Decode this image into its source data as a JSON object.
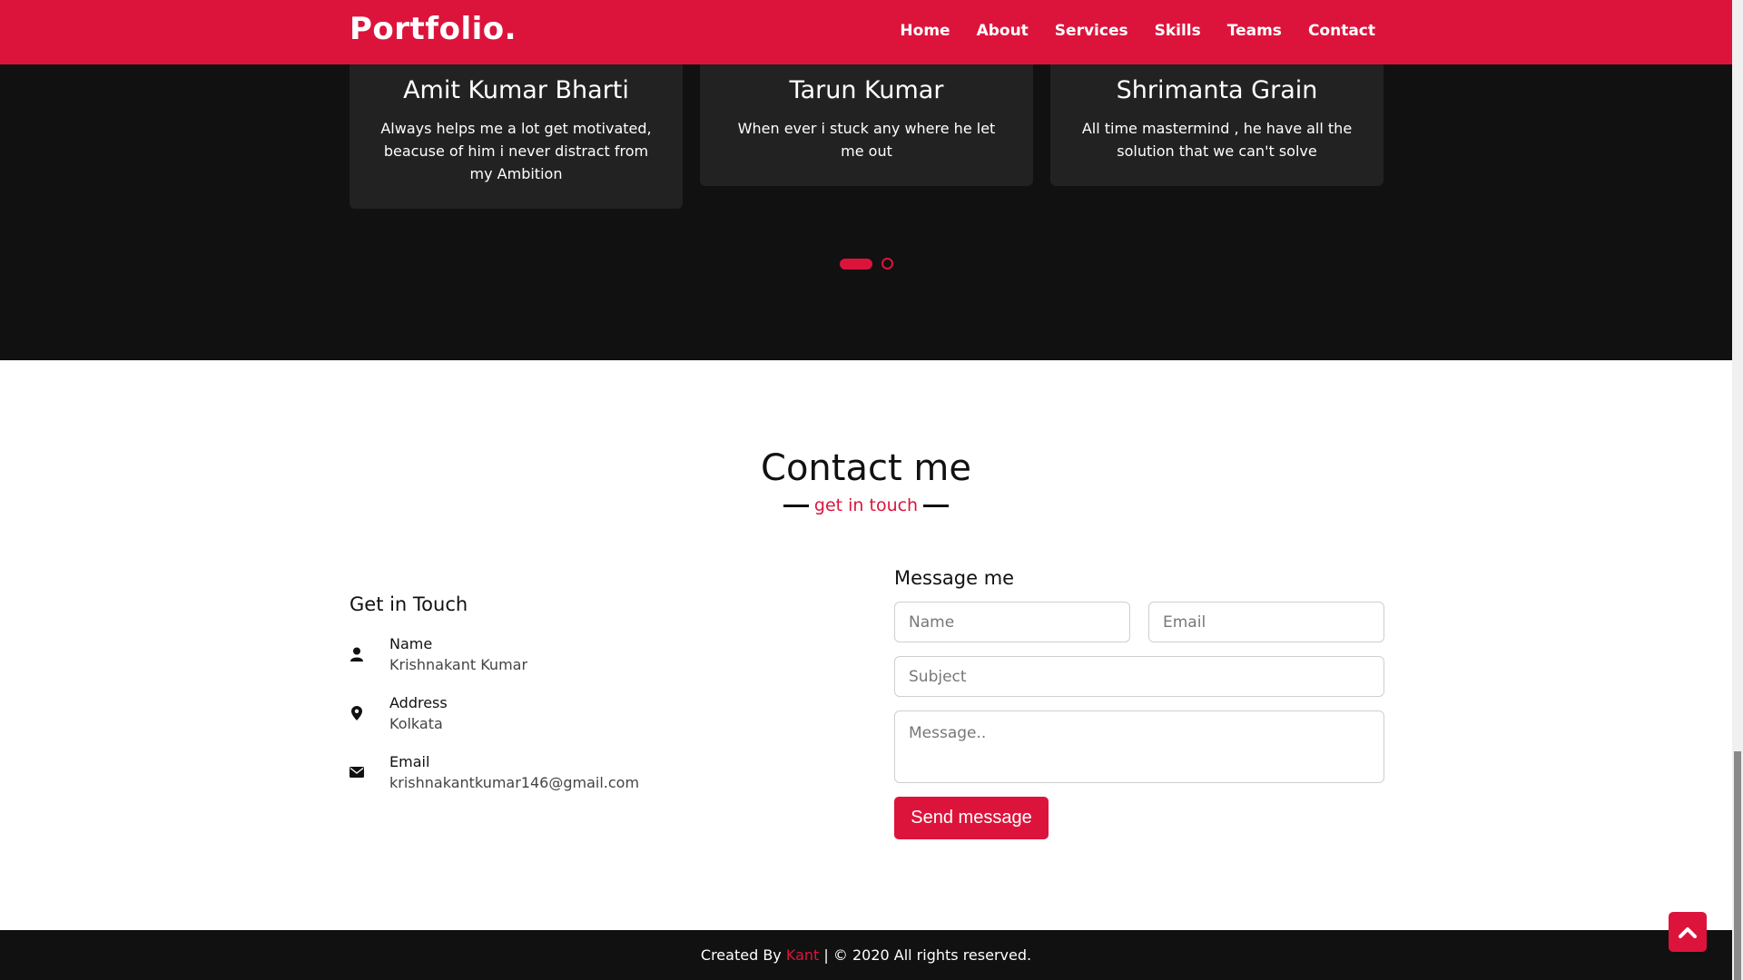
{
  "nav": {
    "logo": "Portfolio.",
    "links": [
      "Home",
      "About",
      "Services",
      "Skills",
      "Teams",
      "Contact"
    ]
  },
  "teams": {
    "cards": [
      {
        "name": "Amit Kumar Bharti",
        "text": "Always helps me a lot get motivated, beacuse of him i never distract from my Ambition"
      },
      {
        "name": "Tarun Kumar",
        "text": "When ever i stuck any where he let me out"
      },
      {
        "name": "Shrimanta Grain",
        "text": "All time mastermind , he have all the solution that we can't solve"
      }
    ]
  },
  "contact": {
    "title": "Contact me",
    "subtitle": "get in touch",
    "get_in_touch": {
      "title": "Get in Touch",
      "items": [
        {
          "head": "Name",
          "value": "Krishnakant Kumar",
          "icon": "user-icon"
        },
        {
          "head": "Address",
          "value": "Kolkata",
          "icon": "map-marker-icon"
        },
        {
          "head": "Email",
          "value": "krishnakantkumar146@gmail.com",
          "icon": "envelope-icon"
        }
      ]
    },
    "form": {
      "title": "Message me",
      "name_placeholder": "Name",
      "email_placeholder": "Email",
      "subject_placeholder": "Subject",
      "message_placeholder": "Message..",
      "send_label": "Send message"
    }
  },
  "footer": {
    "prefix": "Created By",
    "brand": "Kant",
    "suffix": "| © 2020 All rights reserved."
  },
  "colors": {
    "accent": "#dc143c",
    "dark": "#111111",
    "card": "#222222"
  }
}
